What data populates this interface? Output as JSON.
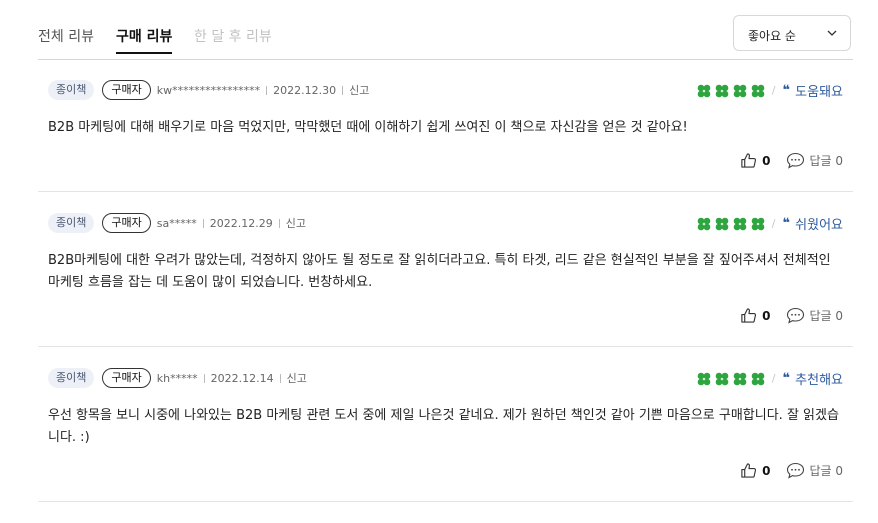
{
  "tabs": [
    {
      "label": "전체 리뷰"
    },
    {
      "label": "구매 리뷰"
    },
    {
      "label": "한 달 후 리뷰"
    }
  ],
  "sort": {
    "selected": "좋아요 순"
  },
  "colors": {
    "clover": "#2fa53f",
    "accent": "#2c5a9e",
    "badge_bg": "#edf1f7"
  },
  "reviews": [
    {
      "type_badge": "종이책",
      "buyer_badge": "구매자",
      "user": "kw****************",
      "date": "2022.12.30",
      "report": "신고",
      "rating": 4,
      "emotion_quote": "❝",
      "emotion": "도움돼요",
      "text": "B2B 마케팅에 대해 배우기로 마음 먹었지만, 막막했던 때에 이해하기 쉽게 쓰여진 이 책으로 자신감을 얻은 것 같아요!",
      "likes": "0",
      "replies": "답글 0"
    },
    {
      "type_badge": "종이책",
      "buyer_badge": "구매자",
      "user": "sa*****",
      "date": "2022.12.29",
      "report": "신고",
      "rating": 4,
      "emotion_quote": "❝",
      "emotion": "쉬웠어요",
      "text": "B2B마케팅에 대한 우려가 많았는데, 걱정하지 않아도 될 정도로 잘 읽히더라고요. 특히 타겟, 리드 같은 현실적인 부분을 잘 짚어주셔서 전체적인 마케팅 흐름을 잡는 데 도움이 많이 되었습니다. 번창하세요.",
      "likes": "0",
      "replies": "답글 0"
    },
    {
      "type_badge": "종이책",
      "buyer_badge": "구매자",
      "user": "kh*****",
      "date": "2022.12.14",
      "report": "신고",
      "rating": 4,
      "emotion_quote": "❝",
      "emotion": "추천해요",
      "text": "우선 항목을 보니 시중에 나와있는 B2B 마케팅 관련 도서 중에 제일 나은것 같네요. 제가 원하던 책인것 같아 기쁜 마음으로 구매합니다. 잘 읽겠습니다. :)",
      "likes": "0",
      "replies": "답글 0"
    }
  ]
}
